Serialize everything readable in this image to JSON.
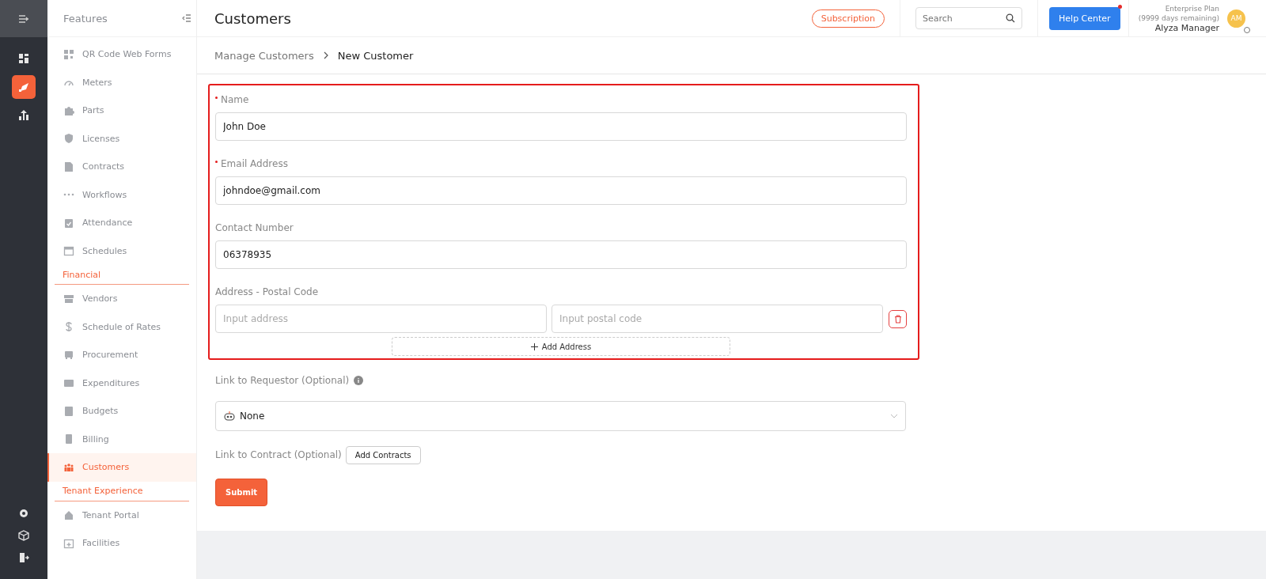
{
  "sidebar": {
    "title": "Features",
    "items": [
      {
        "kind": "item",
        "label": "QR Code Web Forms",
        "selected": false
      },
      {
        "kind": "item",
        "label": "Meters",
        "selected": false
      },
      {
        "kind": "item",
        "label": "Parts",
        "selected": false
      },
      {
        "kind": "item",
        "label": "Licenses",
        "selected": false
      },
      {
        "kind": "item",
        "label": "Contracts",
        "selected": false
      },
      {
        "kind": "item",
        "label": "Workflows",
        "selected": false
      },
      {
        "kind": "item",
        "label": "Attendance",
        "selected": false
      },
      {
        "kind": "item",
        "label": "Schedules",
        "selected": false
      },
      {
        "kind": "section",
        "label": "Financial"
      },
      {
        "kind": "item",
        "label": "Vendors",
        "selected": false
      },
      {
        "kind": "item",
        "label": "Schedule of Rates",
        "selected": false
      },
      {
        "kind": "item",
        "label": "Procurement",
        "selected": false
      },
      {
        "kind": "item",
        "label": "Expenditures",
        "selected": false
      },
      {
        "kind": "item",
        "label": "Budgets",
        "selected": false
      },
      {
        "kind": "item",
        "label": "Billing",
        "selected": false
      },
      {
        "kind": "item",
        "label": "Customers",
        "selected": true
      },
      {
        "kind": "section",
        "label": "Tenant Experience"
      },
      {
        "kind": "item",
        "label": "Tenant Portal",
        "selected": false
      },
      {
        "kind": "item",
        "label": "Facilities",
        "selected": false
      }
    ]
  },
  "rail": {
    "items": [
      {
        "selected": false
      },
      {
        "selected": true
      },
      {
        "selected": false
      }
    ]
  },
  "header": {
    "title": "Customers",
    "subscription_button": "Subscription",
    "search": {
      "placeholder": "Search"
    },
    "help_button": "Help Center",
    "plan": "Enterprise Plan",
    "plan_remaining": "(9999 days remaining)",
    "user_name": "Alyza Manager",
    "avatar_initials": "AM"
  },
  "breadcrumb": [
    "Manage Customers",
    "New Customer"
  ],
  "form": {
    "highlighted_fields": [
      {
        "kind": "text",
        "label": "Name",
        "required": true,
        "value": "John Doe"
      },
      {
        "kind": "text",
        "label": "Email Address",
        "required": true,
        "value": "johndoe@gmail.com"
      },
      {
        "kind": "text",
        "label": "Contact Number",
        "required": false,
        "value": "06378935"
      },
      {
        "kind": "address",
        "label": "Address - Postal Code",
        "required": false,
        "address_placeholder": "Input address",
        "postal_placeholder": "Input postal code"
      }
    ],
    "add_address_button": "Add Address",
    "requestor": {
      "label": "Link to Requestor (Optional)",
      "value": "None"
    },
    "contract": {
      "label": "Link to Contract (Optional)",
      "button": "Add Contracts"
    },
    "submit_button": "Submit"
  }
}
